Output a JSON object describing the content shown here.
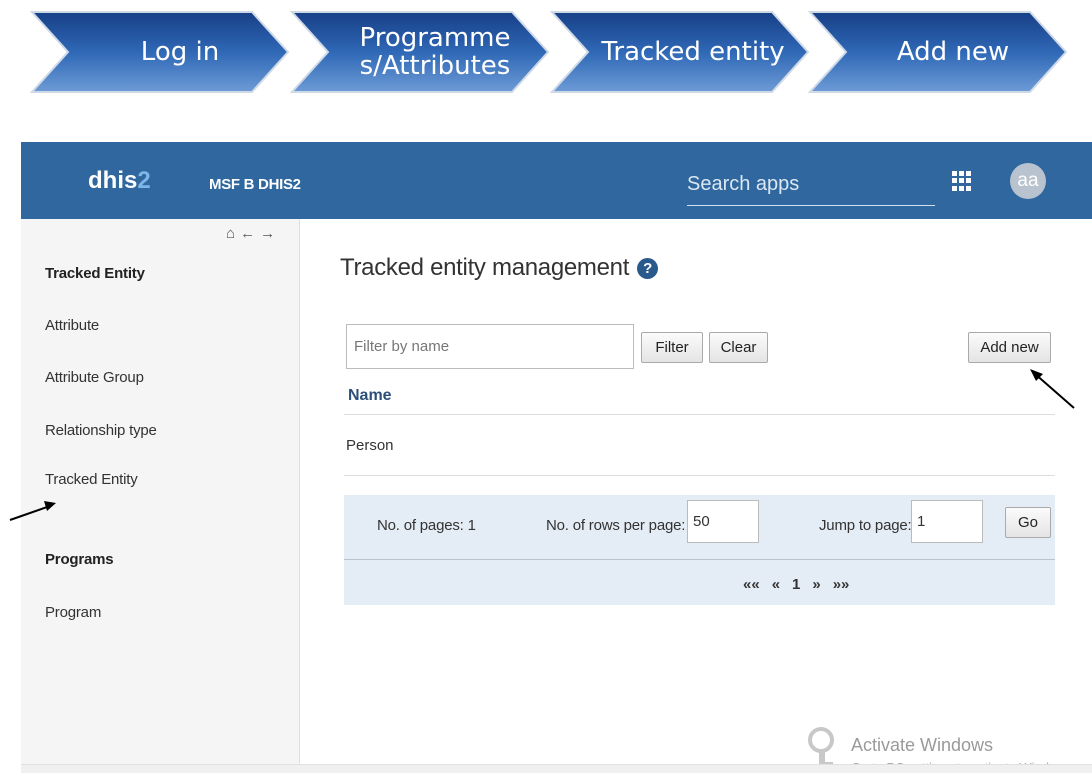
{
  "steps": [
    "Log in",
    "Programmes/Attributes",
    "Tracked entity",
    "Add new"
  ],
  "step_lines": [
    [
      "Log in"
    ],
    [
      "Programme",
      "s/Attributes"
    ],
    [
      "Tracked entity"
    ],
    [
      "Add new"
    ]
  ],
  "header": {
    "logo_prefix": "dhis",
    "logo_suffix": "2",
    "instance_name": "MSF B DHIS2",
    "search_placeholder": "Search apps",
    "avatar_initials": "aa",
    "apps_icon": "grid-icon"
  },
  "sidebar": {
    "nav_icons": [
      "home-icon",
      "back-arrow-icon",
      "forward-arrow-icon"
    ],
    "nav_glyphs": [
      "⌂",
      "←",
      "→"
    ],
    "sections": [
      {
        "heading": "Tracked Entity",
        "items": [
          "Attribute",
          "Attribute Group",
          "Relationship type",
          "Tracked Entity"
        ]
      },
      {
        "heading": "Programs",
        "items": [
          "Program"
        ]
      }
    ]
  },
  "main": {
    "title": "Tracked entity management",
    "help_glyph": "?",
    "filter_placeholder": "Filter by name",
    "filter_button": "Filter",
    "clear_button": "Clear",
    "add_button": "Add new",
    "column_header": "Name",
    "rows": [
      "Person"
    ]
  },
  "pager": {
    "pages_label": "No. of pages: 1",
    "rows_label": "No. of rows per page:",
    "rows_value": "50",
    "jump_label": "Jump to page:",
    "jump_value": "1",
    "go_button": "Go",
    "links": [
      "«« ",
      "«",
      "1",
      "»",
      "»»"
    ]
  },
  "watermark": {
    "title": "Activate Windows",
    "subtitle": "Go to PC settings to activate Windows."
  },
  "colors": {
    "header_bg": "#2f679e",
    "chevron_top": "#1c4e9a",
    "chevron_bottom": "#5f90cf",
    "sidebar_bg": "#f5f5f5",
    "pager_bg": "#e4ecf5"
  }
}
